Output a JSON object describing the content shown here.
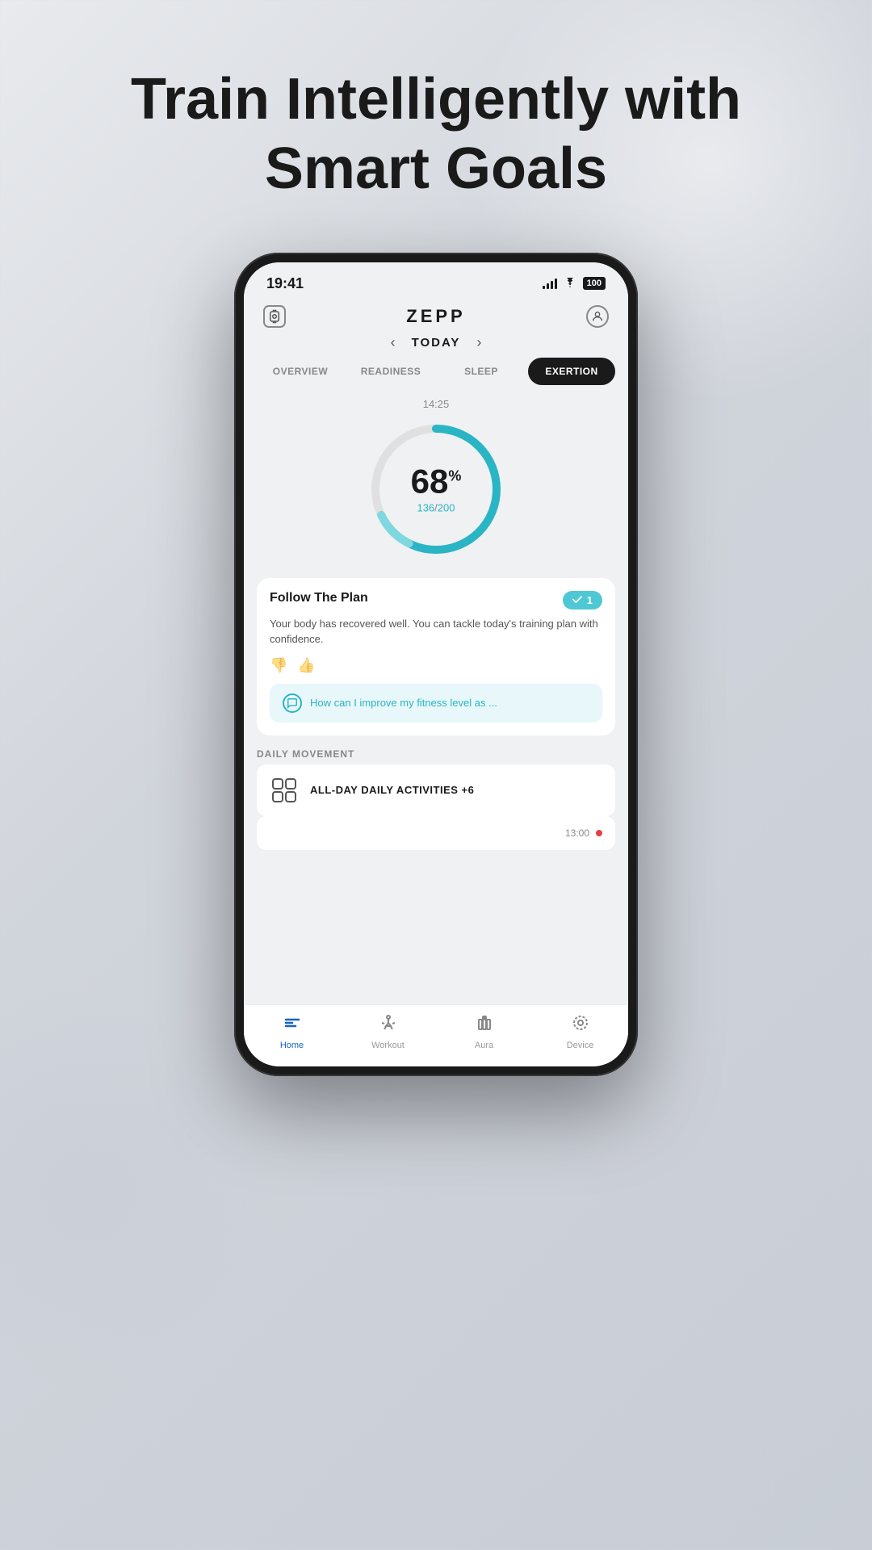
{
  "page": {
    "headline": "Train Intelligently with Smart Goals"
  },
  "status_bar": {
    "time": "19:41",
    "battery": "100"
  },
  "header": {
    "logo": "ZEPP",
    "watch_icon": "⌚",
    "profile_icon": "👤"
  },
  "date_nav": {
    "label": "TODAY",
    "prev_arrow": "‹",
    "next_arrow": "›"
  },
  "tabs": [
    {
      "label": "OVERVIEW",
      "active": false
    },
    {
      "label": "READINESS",
      "active": false
    },
    {
      "label": "SLEEP",
      "active": false
    },
    {
      "label": "EXERTION",
      "active": true
    }
  ],
  "circle": {
    "time": "14:25",
    "percent": "68",
    "current": "136",
    "max": "200",
    "progress": 0.68
  },
  "follow_plan_card": {
    "title": "Follow The Plan",
    "badge": "1",
    "text": "Your body has recovered well. You can tackle today's training plan with confidence.",
    "ai_prompt": "How can I improve my fitness level as ..."
  },
  "daily_movement": {
    "section_label": "DAILY MOVEMENT",
    "activity": {
      "name": "ALL-DAY DAILY ACTIVITIES +6",
      "time": "13:00"
    }
  },
  "bottom_nav": {
    "items": [
      {
        "label": "Home",
        "active": true
      },
      {
        "label": "Workout",
        "active": false
      },
      {
        "label": "Aura",
        "active": false
      },
      {
        "label": "Device",
        "active": false
      }
    ]
  },
  "colors": {
    "teal": "#2ab5c5",
    "dark": "#1a1a1a",
    "blue": "#1565c0"
  }
}
